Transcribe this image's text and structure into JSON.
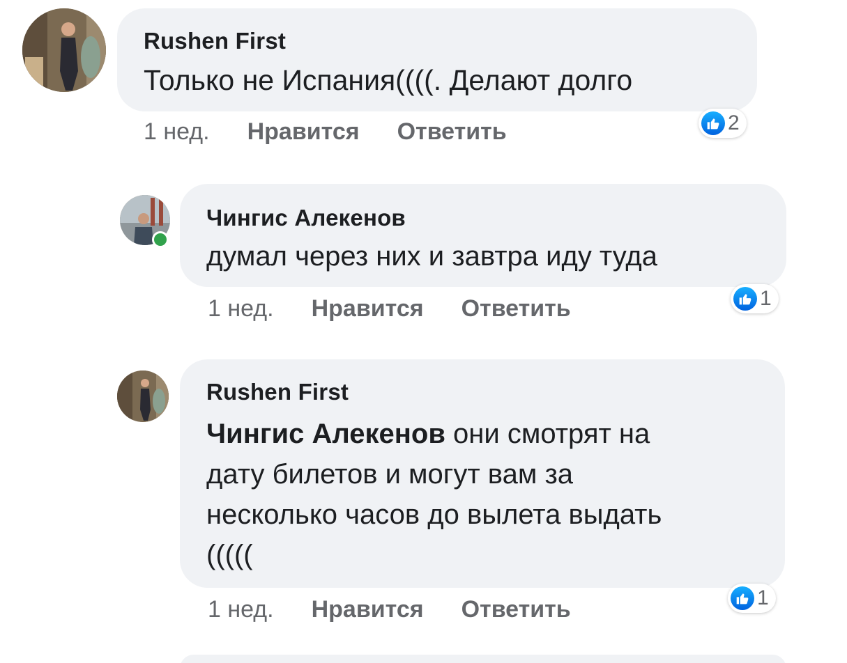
{
  "comments": [
    {
      "author": "Rushen First",
      "text": "Только не Испания((((. Делают долго",
      "time": "1 нед.",
      "like_label": "Нравится",
      "reply_label": "Ответить",
      "reaction_icon": "thumbs-up-icon",
      "reaction_count": "2"
    },
    {
      "author": "Чингис Алекенов",
      "text": "думал через них и завтра иду туда",
      "time": "1 нед.",
      "like_label": "Нравится",
      "reply_label": "Ответить",
      "reaction_icon": "thumbs-up-icon",
      "reaction_count": "1",
      "online": true
    },
    {
      "author": "Rushen First",
      "mention": "Чингис Алекенов",
      "text_line1": " они смотрят на",
      "text_line2": "дату билетов и могут вам за",
      "text_line3": "несколько часов до вылета выдать",
      "text_line4": "(((((",
      "time": "1 нед.",
      "like_label": "Нравится",
      "reply_label": "Ответить",
      "reaction_icon": "thumbs-up-icon",
      "reaction_count": "1"
    }
  ],
  "colors": {
    "bubble": "#f0f2f5",
    "text": "#1c1e21",
    "meta": "#65676b",
    "like_blue": "#0866ff",
    "online": "#31a24c"
  }
}
